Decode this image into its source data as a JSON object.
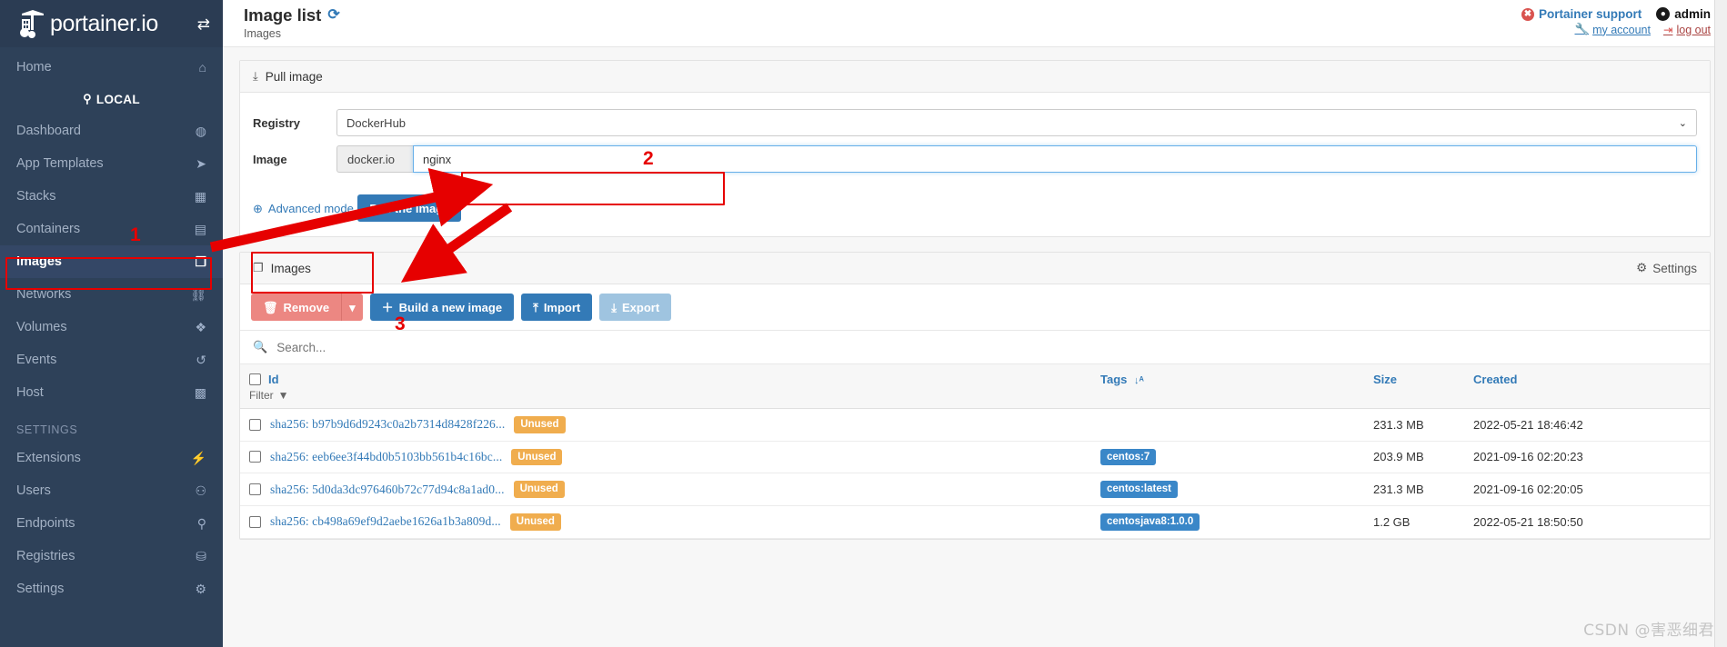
{
  "brand": {
    "name": "portainer.io",
    "toggle_icon": "exchange-arrows-icon"
  },
  "sidebar": {
    "home": {
      "label": "Home",
      "icon": "home-icon"
    },
    "endpoint": {
      "label": "LOCAL",
      "icon": "plug-icon"
    },
    "items": [
      {
        "label": "Dashboard",
        "icon": "dashboard-icon",
        "active": false
      },
      {
        "label": "App Templates",
        "icon": "rocket-icon",
        "active": false
      },
      {
        "label": "Stacks",
        "icon": "stacks-icon",
        "active": false
      },
      {
        "label": "Containers",
        "icon": "containers-icon",
        "active": false
      },
      {
        "label": "Images",
        "icon": "images-icon",
        "active": true
      },
      {
        "label": "Networks",
        "icon": "network-icon",
        "active": false
      },
      {
        "label": "Volumes",
        "icon": "volumes-icon",
        "active": false
      },
      {
        "label": "Events",
        "icon": "clock-icon",
        "active": false
      },
      {
        "label": "Host",
        "icon": "grid-icon",
        "active": false
      }
    ],
    "settings_section": "SETTINGS",
    "settings_items": [
      {
        "label": "Extensions",
        "icon": "bolt-icon"
      },
      {
        "label": "Users",
        "icon": "users-icon"
      },
      {
        "label": "Endpoints",
        "icon": "plug-icon"
      },
      {
        "label": "Registries",
        "icon": "registry-icon"
      },
      {
        "label": "Settings",
        "icon": "gears-icon"
      }
    ]
  },
  "header": {
    "title": "Image list",
    "refresh_icon": "refresh-icon",
    "breadcrumb": "Images",
    "support_label": "Portainer support",
    "support_icon": "lifebuoy-icon",
    "user_name": "admin",
    "user_icon": "user-circle-icon",
    "my_account_label": "my account",
    "my_account_icon": "wrench-icon",
    "logout_label": "log out",
    "logout_icon": "signout-icon"
  },
  "pull_panel": {
    "title": "Pull image",
    "icon": "download-icon",
    "registry_label": "Registry",
    "registry_value": "DockerHub",
    "image_label": "Image",
    "image_prefix": "docker.io",
    "image_value": "nginx",
    "advanced_mode_label": "Advanced mode",
    "advanced_mode_icon": "globe-icon",
    "pull_button_label": "Pull the image"
  },
  "images_panel": {
    "title": "Images",
    "icon": "images-icon",
    "settings_label": "Settings",
    "settings_icon": "gear-icon",
    "toolbar": {
      "remove_label": "Remove",
      "remove_icon": "trash-icon",
      "remove_caret_icon": "caret-down-icon",
      "build_label": "Build a new image",
      "build_icon": "plus-icon",
      "import_label": "Import",
      "import_icon": "upload-icon",
      "export_label": "Export",
      "export_icon": "download-icon"
    },
    "search_placeholder": "Search...",
    "search_icon": "search-icon",
    "columns": {
      "id": "Id",
      "filter": "Filter",
      "filter_icon": "funnel-icon",
      "tags": "Tags",
      "tags_sort_icon": "sort-az-icon",
      "size": "Size",
      "created": "Created"
    },
    "rows": [
      {
        "id": "sha256: b97b9d6d9243c0a2b7314d8428f226...",
        "status": "Unused",
        "tag": "",
        "size": "231.3 MB",
        "created": "2022-05-21 18:46:42"
      },
      {
        "id": "sha256: eeb6ee3f44bd0b5103bb561b4c16bc...",
        "status": "Unused",
        "tag": "centos:7",
        "size": "203.9 MB",
        "created": "2021-09-16 02:20:23"
      },
      {
        "id": "sha256: 5d0da3dc976460b72c77d94c8a1ad0...",
        "status": "Unused",
        "tag": "centos:latest",
        "size": "231.3 MB",
        "created": "2021-09-16 02:20:05"
      },
      {
        "id": "sha256: cb498a69ef9d2aebe1626a1b3a809d...",
        "status": "Unused",
        "tag": "centosjava8:1.0.0",
        "size": "1.2 GB",
        "created": "2022-05-21 18:50:50"
      }
    ]
  },
  "annotations": {
    "step1": "1",
    "step2": "2",
    "step3": "3"
  },
  "watermark": "CSDN @害恶细君",
  "colors": {
    "sidebar_bg": "#2e4159",
    "accent_blue": "#337ab7",
    "danger_red": "#e60000",
    "badge_unused": "#f0ad4e",
    "badge_tag": "#3a87c8"
  }
}
